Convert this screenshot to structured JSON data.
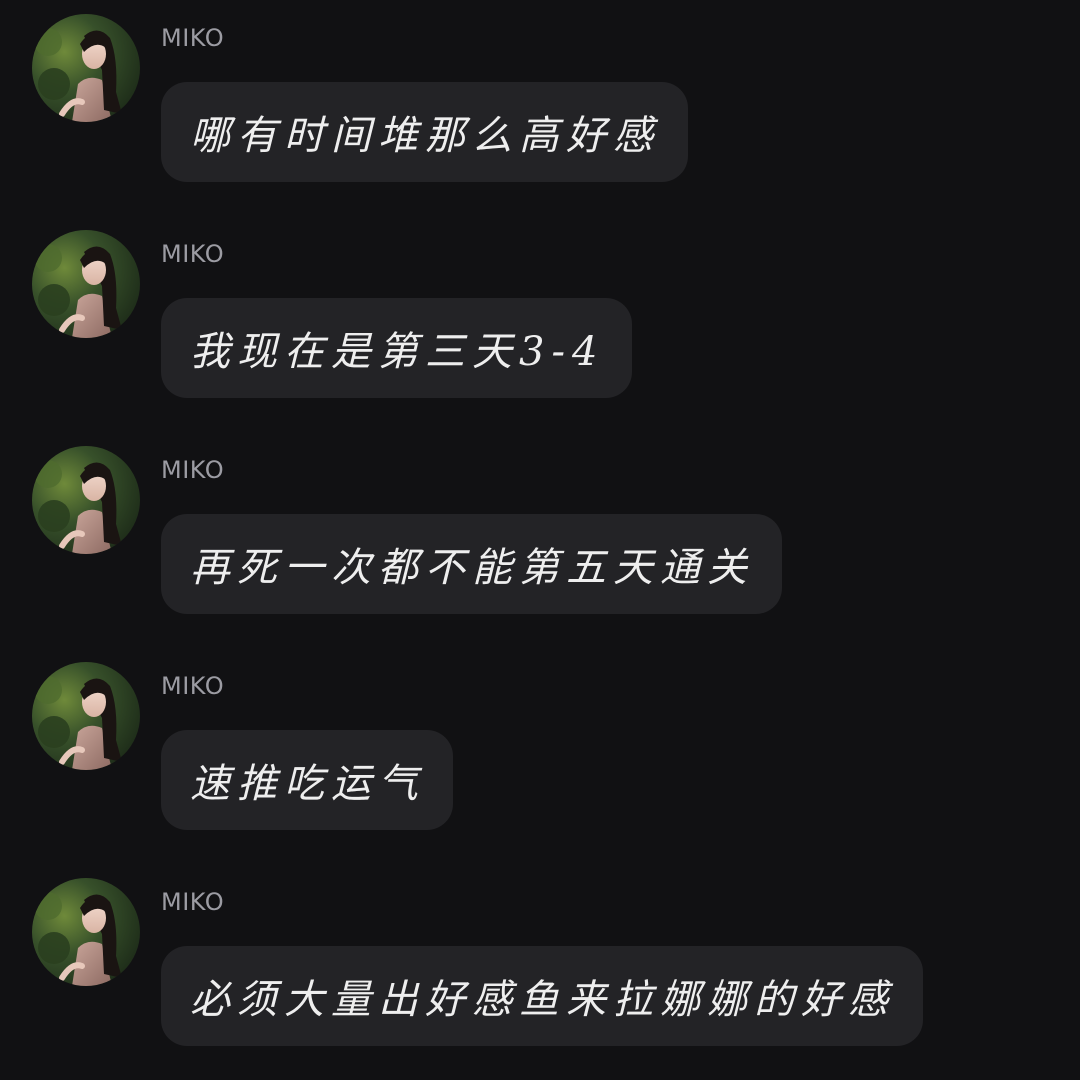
{
  "colors": {
    "background": "#111113",
    "bubble": "#232326",
    "sender_name": "#9c9ca3",
    "message_text": "#eeeeee"
  },
  "messages": [
    {
      "sender": "MIKO",
      "avatar_icon": "user-photo-avatar",
      "text": "哪有时间堆那么高好感"
    },
    {
      "sender": "MIKO",
      "avatar_icon": "user-photo-avatar",
      "text": "我现在是第三天3-4"
    },
    {
      "sender": "MIKO",
      "avatar_icon": "user-photo-avatar",
      "text": "再死一次都不能第五天通关"
    },
    {
      "sender": "MIKO",
      "avatar_icon": "user-photo-avatar",
      "text": "速推吃运气"
    },
    {
      "sender": "MIKO",
      "avatar_icon": "user-photo-avatar",
      "text": "必须大量出好感鱼来拉娜娜的好感"
    }
  ]
}
